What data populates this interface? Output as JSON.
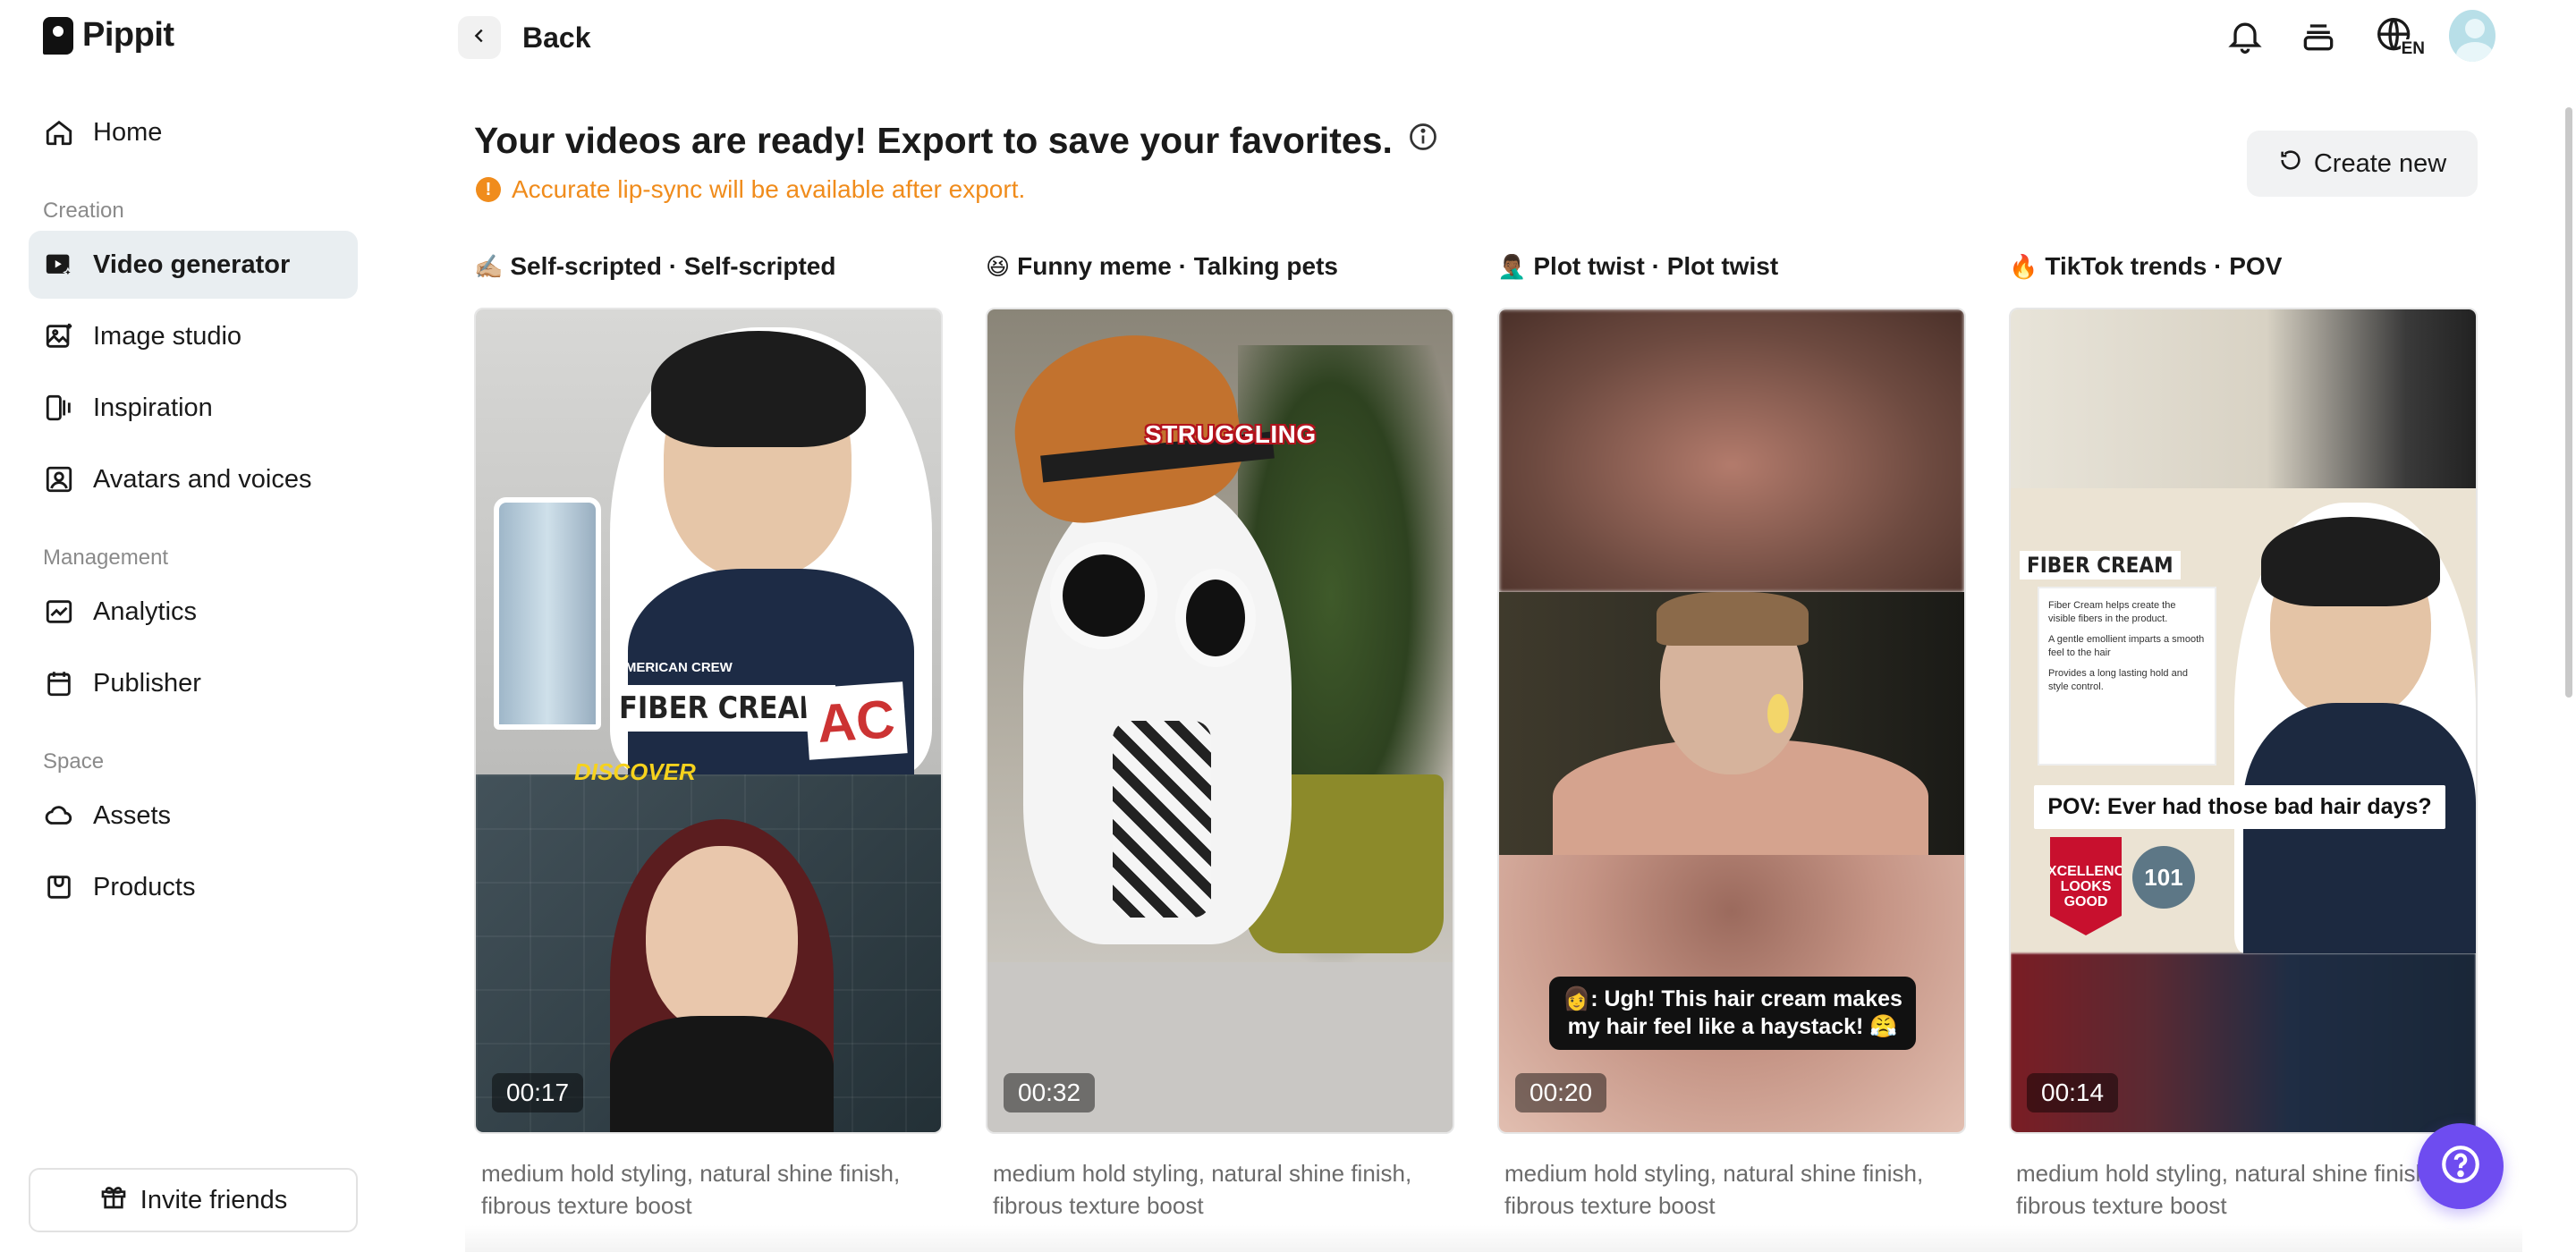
{
  "app": {
    "name": "Pippit"
  },
  "sidebar": {
    "items_top": [
      {
        "label": "Home",
        "icon": "home-icon"
      }
    ],
    "sections": [
      {
        "title": "Creation",
        "items": [
          {
            "label": "Video generator",
            "icon": "video-generator-icon",
            "active": true
          },
          {
            "label": "Image studio",
            "icon": "image-studio-icon"
          },
          {
            "label": "Inspiration",
            "icon": "inspiration-icon"
          },
          {
            "label": "Avatars and voices",
            "icon": "avatar-icon"
          }
        ]
      },
      {
        "title": "Management",
        "items": [
          {
            "label": "Analytics",
            "icon": "analytics-icon"
          },
          {
            "label": "Publisher",
            "icon": "calendar-icon"
          }
        ]
      },
      {
        "title": "Space",
        "items": [
          {
            "label": "Assets",
            "icon": "cloud-icon"
          },
          {
            "label": "Products",
            "icon": "product-box-icon"
          }
        ]
      }
    ],
    "invite_label": "Invite friends"
  },
  "topbar": {
    "back_label": "Back",
    "language_badge": "EN"
  },
  "main": {
    "headline": "Your videos are ready! Export to save your favorites.",
    "warning": "Accurate lip-sync will be available after export.",
    "create_new_label": "Create new",
    "cards": [
      {
        "emoji": "✍🏼",
        "title": "Self-scripted · Self-scripted",
        "duration": "00:17",
        "description": "medium hold styling, natural shine finish, fibrous texture boost",
        "overlay": {
          "small": "AMERICAN CREW",
          "label": "FIBER CREAM",
          "logo": "AC",
          "tag": "DISCOVER"
        }
      },
      {
        "emoji": "😆",
        "title": "Funny meme · Talking pets",
        "duration": "00:32",
        "description": "medium hold styling, natural shine finish, fibrous texture boost",
        "overlay": {
          "caption": "STRUGGLING"
        }
      },
      {
        "emoji": "🤦🏾‍♂️",
        "title": "Plot twist · Plot twist",
        "duration": "00:20",
        "description": "medium hold styling, natural shine finish, fibrous texture boost",
        "overlay": {
          "caption": "👩: Ugh! This hair cream makes my hair feel like a haystack! 😤"
        }
      },
      {
        "emoji": "🔥",
        "title": "TikTok trends · POV",
        "duration": "00:14",
        "description": "medium hold styling, natural shine finish, fibrous texture boost",
        "overlay": {
          "brand": "FIBER CREAM",
          "notes": [
            "Fiber Cream helps create the visible fibers in the product.",
            "A gentle emollient imparts a smooth feel to the hair",
            "Provides a long lasting hold and style control."
          ],
          "pov": "POV: Ever had those bad hair days?",
          "badge": "EXCELLENCE LOOKS GOOD",
          "circle": "101"
        }
      }
    ]
  },
  "colors": {
    "accent": "#6e4cf0",
    "warning": "#f08c1c",
    "active_nav_bg": "#e9eef1"
  }
}
